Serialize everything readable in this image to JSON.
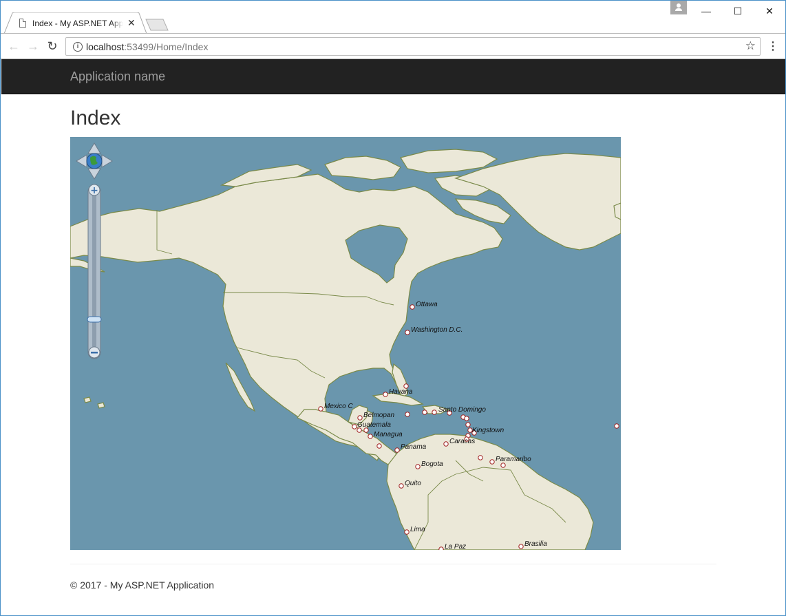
{
  "browser": {
    "tab_title": "Index - My ASP.NET Application",
    "tab_close": "✕",
    "url_host": "localhost",
    "url_path": ":53499/Home/Index",
    "window_minimize": "—",
    "window_maximize": "☐",
    "window_close": "✕"
  },
  "navbar": {
    "brand": "Application name"
  },
  "page": {
    "title": "Index"
  },
  "map": {
    "cities": [
      {
        "name": "Ottawa"
      },
      {
        "name": "Washington D.C."
      },
      {
        "name": "Havana"
      },
      {
        "name": "Mexico C"
      },
      {
        "name": "Belmopan"
      },
      {
        "name": "Guatemala"
      },
      {
        "name": "Managua"
      },
      {
        "name": "Santo Domingo"
      },
      {
        "name": "Kingstown"
      },
      {
        "name": "Caracas"
      },
      {
        "name": "Panama"
      },
      {
        "name": "Paramaribo"
      },
      {
        "name": "Bogota"
      },
      {
        "name": "Quito"
      },
      {
        "name": "Lima"
      },
      {
        "name": "La Paz"
      },
      {
        "name": "Brasilia"
      }
    ],
    "colors": {
      "ocean": "#6a96ad",
      "land": "#ebe8d8",
      "border": "#7a8a4a",
      "marker": "#a02020"
    }
  },
  "footer": {
    "text": "© 2017 - My ASP.NET Application"
  }
}
